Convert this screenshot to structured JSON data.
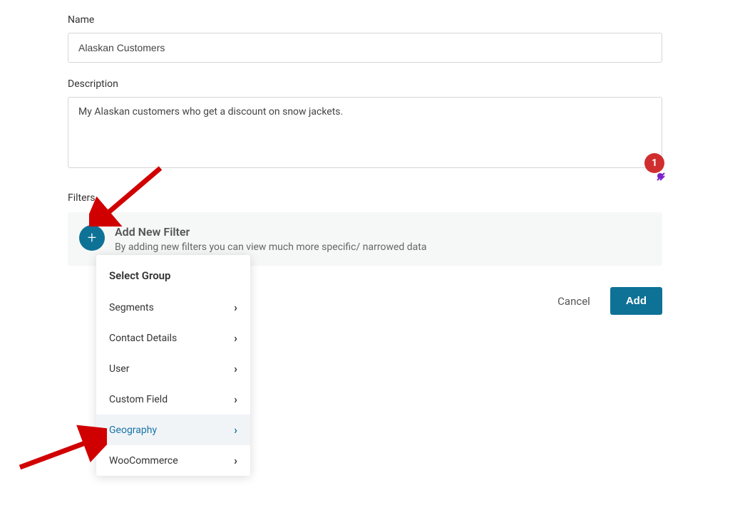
{
  "name": {
    "label": "Name",
    "value": "Alaskan Customers"
  },
  "description": {
    "label": "Description",
    "value": "My Alaskan customers who get a discount on snow jackets."
  },
  "badge_count": "1",
  "filters": {
    "section_label": "Filters",
    "title": "Add New Filter",
    "subtitle": "By adding new filters you can view much more specific/ narrowed data",
    "plus": "+"
  },
  "actions": {
    "cancel": "Cancel",
    "add": "Add"
  },
  "dropdown": {
    "title": "Select Group",
    "items": [
      {
        "label": "Segments",
        "selected": false
      },
      {
        "label": "Contact Details",
        "selected": false
      },
      {
        "label": "User",
        "selected": false
      },
      {
        "label": "Custom Field",
        "selected": false
      },
      {
        "label": "Geography",
        "selected": true
      },
      {
        "label": "WooCommerce",
        "selected": false
      }
    ]
  }
}
